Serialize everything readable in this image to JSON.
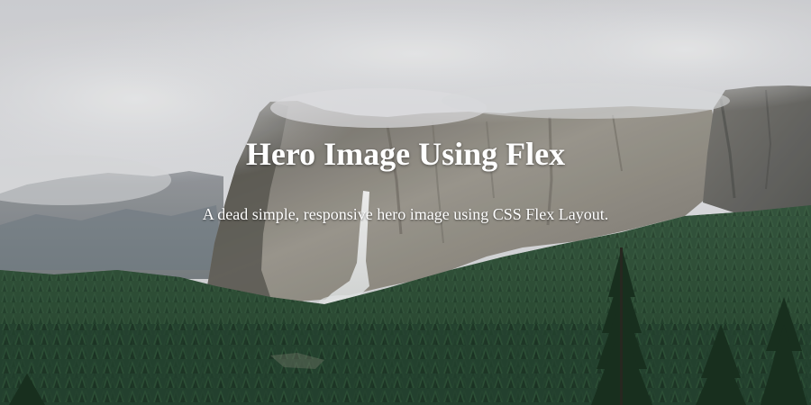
{
  "hero": {
    "title": "Hero Image Using Flex",
    "subtitle": "A dead simple, responsive hero image using CSS Flex Layout."
  },
  "background": {
    "icon": "yosemite-valley-landscape-image",
    "colors": {
      "sky": "#dcdde0",
      "cloud": "#eceef0",
      "rock_light": "#9f9c93",
      "rock_dark": "#6a6862",
      "forest_dark": "#1f3b27",
      "forest_mid": "#2f5236",
      "waterfall": "#f2f4f4",
      "text": "#ffffff"
    }
  }
}
